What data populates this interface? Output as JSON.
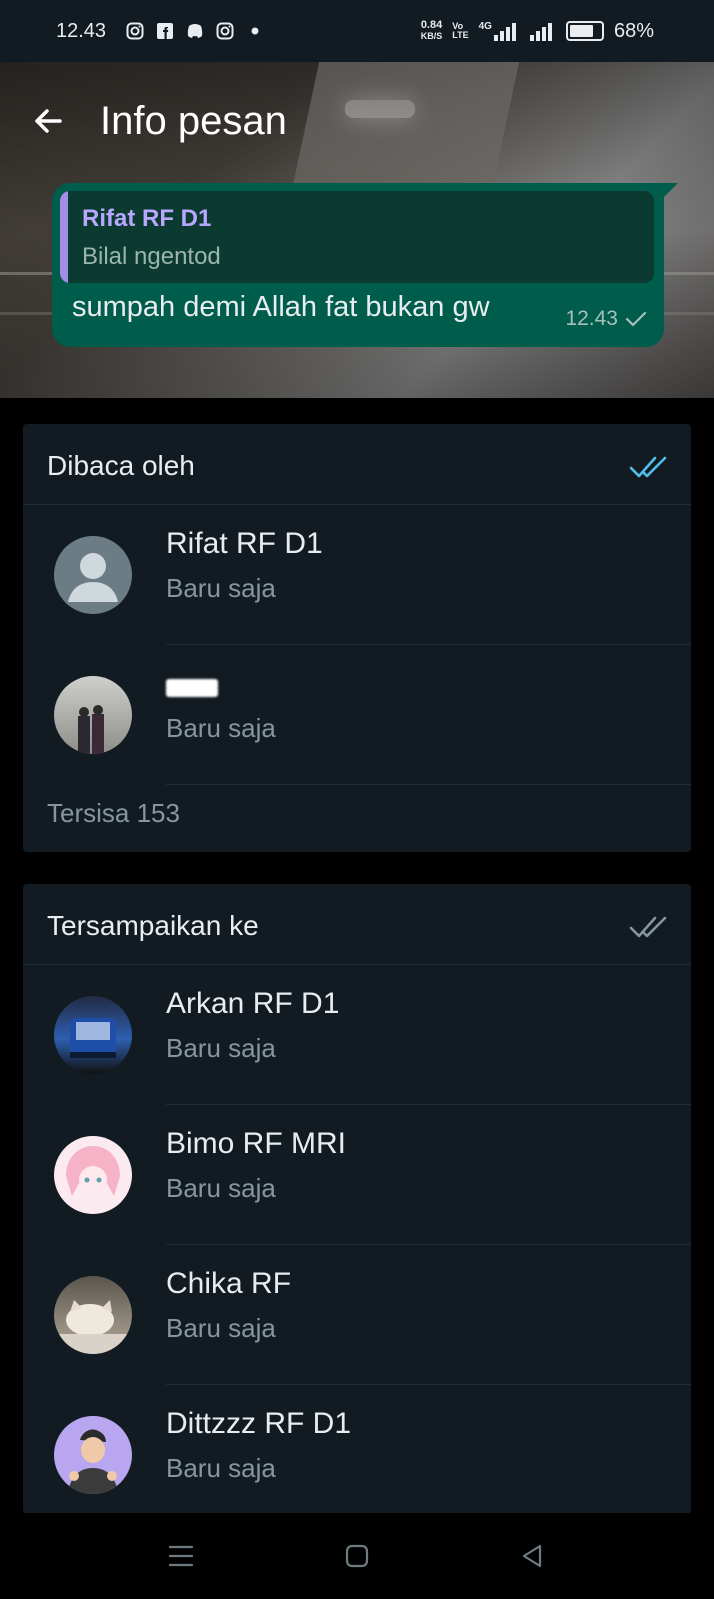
{
  "status_bar": {
    "time": "12.43",
    "net_speed_value": "0.84",
    "net_speed_unit": "KB/S",
    "volte_top": "Vo",
    "volte_bottom": "LTE",
    "network_type": "4G",
    "battery_percent": "68%",
    "battery_level": 0.68,
    "notification_icons": [
      "instagram-icon",
      "facebook-icon",
      "discord-icon",
      "instagram-icon",
      "dot-icon"
    ]
  },
  "header": {
    "title": "Info pesan",
    "back_icon": "arrow-left-icon"
  },
  "message": {
    "quoted_name": "Rifat RF D1",
    "quoted_text": "Bilal ngentod",
    "text": "sumpah demi Allah fat bukan gw",
    "time": "12.43",
    "status_icon": "single-check-icon"
  },
  "read_by": {
    "title": "Dibaca oleh",
    "status_icon": "double-check-blue-icon",
    "accent": "#53bdeb",
    "items": [
      {
        "name": "Rifat RF D1",
        "status": "Baru saja",
        "avatar": "default-avatar-icon"
      },
      {
        "name": "",
        "status": "Baru saja",
        "avatar": "photo-avatar"
      }
    ],
    "remaining": "Tersisa 153"
  },
  "delivered_to": {
    "title": "Tersampaikan ke",
    "status_icon": "double-check-grey-icon",
    "items": [
      {
        "name": "Arkan RF D1",
        "status": "Baru saja",
        "avatar": "photo-avatar"
      },
      {
        "name": "Bimo RF MRI",
        "status": "Baru saja",
        "avatar": "photo-avatar"
      },
      {
        "name": "Chika RF",
        "status": "Baru saja",
        "avatar": "photo-avatar"
      },
      {
        "name": "Dittzzz RF D1",
        "status": "Baru saja",
        "avatar": "photo-avatar"
      }
    ]
  },
  "navigation": {
    "menu_icon": "menu-icon",
    "home_icon": "home-square-icon",
    "back_icon": "back-triangle-icon"
  },
  "colors": {
    "bubble": "#005c4b",
    "quote_name": "#b8a7ff",
    "card_bg": "#111b21",
    "secondary_text": "#8696a0"
  }
}
